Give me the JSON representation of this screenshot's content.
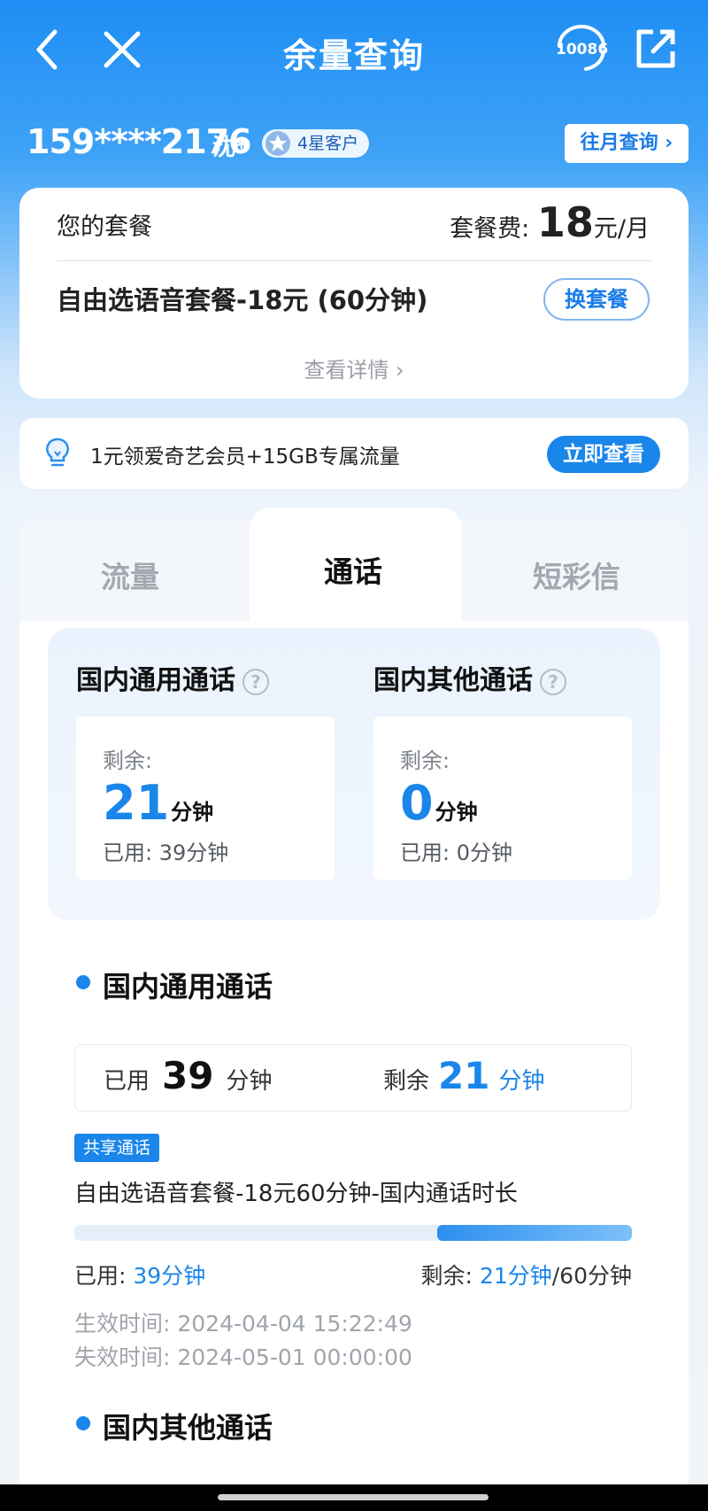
{
  "header": {
    "title": "余量查询",
    "service_number": "10086"
  },
  "user": {
    "phone": "159****2176",
    "name": "沈*",
    "level": "4星客户",
    "history_button": "往月查询 ›"
  },
  "plan": {
    "label": "您的套餐",
    "fee_prefix": "套餐费:",
    "fee_amount": "18",
    "fee_unit": "元/月",
    "name": "自由选语音套餐-18元 (60分钟)",
    "change_button": "换套餐",
    "details_link": "查看详情 ›"
  },
  "promo": {
    "text": "1元领爱奇艺会员+15GB专属流量",
    "button": "立即查看"
  },
  "tabs": [
    {
      "label": "流量",
      "active": false
    },
    {
      "label": "通话",
      "active": true
    },
    {
      "label": "短彩信",
      "active": false
    }
  ],
  "summary": {
    "general": {
      "title": "国内通用通话",
      "remain_label": "剩余:",
      "remain_value": "21",
      "remain_unit": "分钟",
      "used_text": "已用: 39分钟"
    },
    "other": {
      "title": "国内其他通话",
      "remain_label": "剩余:",
      "remain_value": "0",
      "remain_unit": "分钟",
      "used_text": "已用: 0分钟"
    }
  },
  "detail": {
    "section_title": "国内通用通话",
    "used_label": "已用",
    "used_value": "39",
    "used_unit": "分钟",
    "remain_label": "剩余",
    "remain_value": "21",
    "remain_unit": "分钟",
    "tag": "共享通话",
    "item_name": "自由选语音套餐-18元60分钟-国内通话时长",
    "progress_remaining_fraction": 0.35,
    "usage_used_label": "已用:",
    "usage_used_value": "39分钟",
    "usage_remain_label": "剩余:",
    "usage_remain_value": "21分钟",
    "usage_total": "/60分钟",
    "effective_time": "生效时间: 2024-04-04 15:22:49",
    "expire_time": "失效时间: 2024-05-01 00:00:00"
  },
  "other_section_title": "国内其他通话",
  "colors": {
    "accent": "#1b86ea",
    "header_blue": "#1e8ef5"
  },
  "icons": [
    "back-arrow-icon",
    "close-icon",
    "customer-service-icon",
    "share-icon",
    "star-icon",
    "lightbulb-icon",
    "question-icon"
  ]
}
